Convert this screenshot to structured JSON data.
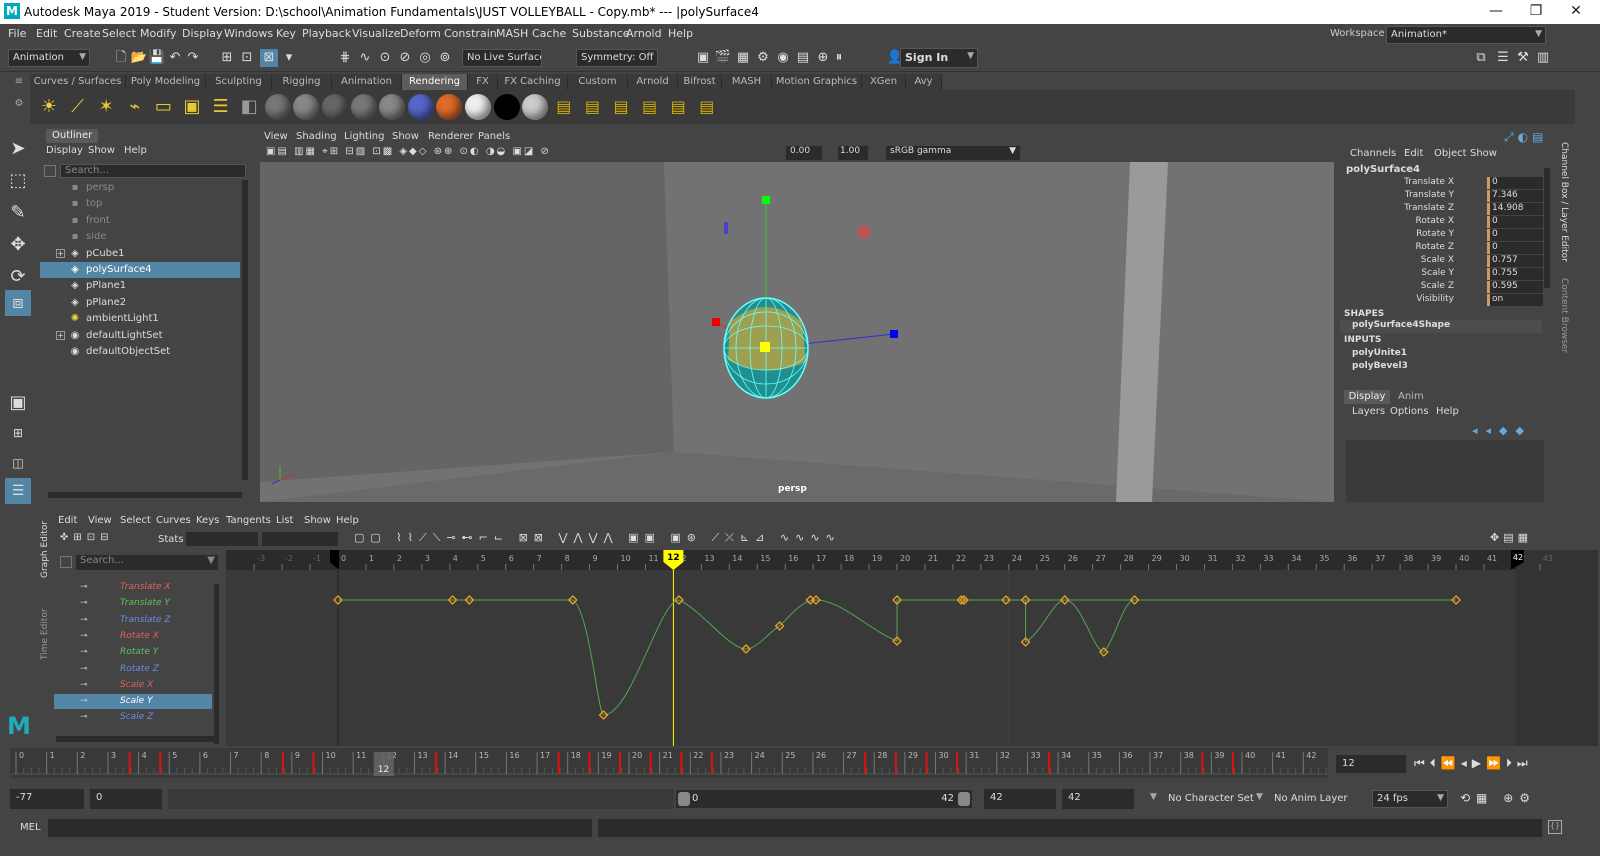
{
  "window": {
    "title": "Autodesk Maya 2019 - Student Version: D:\\school\\Animation Fundamentals\\JUST VOLLEYBALL - Copy.mb*  ---  |polySurface4",
    "controls": [
      "—",
      "❐",
      "✕"
    ]
  },
  "menubar": [
    "File",
    "Edit",
    "Create",
    "Select",
    "Modify",
    "Display",
    "Windows",
    "Key",
    "Playback",
    "Visualize",
    "Deform",
    "Constrain",
    "MASH",
    "Cache",
    "Substance",
    "Arnold",
    "Help"
  ],
  "workspace": {
    "label": "Workspace :",
    "value": "Animation*"
  },
  "toolbar": {
    "menuset": "Animation",
    "live_surface": "No Live Surface",
    "symmetry": "Symmetry: Off",
    "sign_in": "Sign In"
  },
  "shelf_tabs": [
    "Curves / Surfaces",
    "Poly Modeling",
    "Sculpting",
    "Rigging",
    "Animation",
    "Rendering",
    "FX",
    "FX Caching",
    "Custom",
    "Arnold",
    "Bifrost",
    "MASH",
    "Motion Graphics",
    "XGen",
    "Avy"
  ],
  "shelf_active": "Rendering",
  "outliner": {
    "tab": "Outliner",
    "menu": [
      "Display",
      "Show",
      "Help"
    ],
    "search_placeholder": "Search...",
    "items": [
      {
        "label": "persp",
        "icon": "camera-icon",
        "dim": true,
        "plus": false
      },
      {
        "label": "top",
        "icon": "camera-icon",
        "dim": true,
        "plus": false
      },
      {
        "label": "front",
        "icon": "camera-icon",
        "dim": true,
        "plus": false
      },
      {
        "label": "side",
        "icon": "camera-icon",
        "dim": true,
        "plus": false
      },
      {
        "label": "pCube1",
        "icon": "mesh-icon",
        "dim": false,
        "plus": true
      },
      {
        "label": "polySurface4",
        "icon": "mesh-icon",
        "dim": false,
        "plus": false,
        "selected": true
      },
      {
        "label": "pPlane1",
        "icon": "mesh-icon",
        "dim": false,
        "plus": false
      },
      {
        "label": "pPlane2",
        "icon": "mesh-icon",
        "dim": false,
        "plus": false
      },
      {
        "label": "ambientLight1",
        "icon": "light-icon",
        "dim": false,
        "plus": false
      },
      {
        "label": "defaultLightSet",
        "icon": "set-icon",
        "dim": false,
        "plus": true
      },
      {
        "label": "defaultObjectSet",
        "icon": "set-icon",
        "dim": false,
        "plus": false
      }
    ]
  },
  "viewport": {
    "menu": [
      "View",
      "Shading",
      "Lighting",
      "Show",
      "Renderer",
      "Panels"
    ],
    "exposure": "0.00",
    "gamma": "1.00",
    "colorspace": "sRGB gamma",
    "camera_label": "persp"
  },
  "channelbox": {
    "menu": [
      "Channels",
      "Edit",
      "Object",
      "Show"
    ],
    "object": "polySurface4",
    "channels": [
      {
        "name": "Translate X",
        "value": "0"
      },
      {
        "name": "Translate Y",
        "value": "7.346"
      },
      {
        "name": "Translate Z",
        "value": "14.908"
      },
      {
        "name": "Rotate X",
        "value": "0"
      },
      {
        "name": "Rotate Y",
        "value": "0"
      },
      {
        "name": "Rotate Z",
        "value": "0"
      },
      {
        "name": "Scale X",
        "value": "0.757"
      },
      {
        "name": "Scale Y",
        "value": "0.755"
      },
      {
        "name": "Scale Z",
        "value": "0.595"
      },
      {
        "name": "Visibility",
        "value": "on"
      }
    ],
    "shapes_header": "SHAPES",
    "shape": "polySurface4Shape",
    "inputs_header": "INPUTS",
    "inputs": [
      "polyUnite1",
      "polyBevel3"
    ],
    "layer_tabs": [
      "Display",
      "Anim"
    ],
    "layer_menu": [
      "Layers",
      "Options",
      "Help"
    ],
    "side_tabs": [
      "Channel Box / Layer Editor",
      "Content Browser"
    ]
  },
  "graph_editor": {
    "menu": [
      "Edit",
      "View",
      "Select",
      "Curves",
      "Keys",
      "Tangents",
      "List",
      "Show",
      "Help"
    ],
    "stats_label": "Stats",
    "search_placeholder": "Search...",
    "side_tabs": [
      "Graph Editor",
      "Time Editor"
    ],
    "curves": [
      {
        "label": "Translate X",
        "color": "#e06060"
      },
      {
        "label": "Translate Y",
        "color": "#60c060"
      },
      {
        "label": "Translate Z",
        "color": "#6a8ce0"
      },
      {
        "label": "Rotate X",
        "color": "#e06060"
      },
      {
        "label": "Rotate Y",
        "color": "#60c060"
      },
      {
        "label": "Rotate Z",
        "color": "#6a8ce0"
      },
      {
        "label": "Scale X",
        "color": "#e06060"
      },
      {
        "label": "Scale Y",
        "color": "#ffffff",
        "selected": true
      },
      {
        "label": "Scale Z",
        "color": "#6a8ce0"
      }
    ],
    "ruler": [
      "-3",
      "-2",
      "-1",
      "0",
      "1",
      "2",
      "3",
      "4",
      "5",
      "6",
      "7",
      "8",
      "9",
      "10",
      "11",
      "12",
      "13",
      "14",
      "15",
      "16",
      "17",
      "18",
      "19",
      "20",
      "21",
      "22",
      "23",
      "24",
      "25",
      "26",
      "27",
      "28",
      "29",
      "30",
      "31",
      "32",
      "33",
      "34",
      "35",
      "36",
      "37",
      "38",
      "39",
      "40",
      "41",
      "42",
      "43"
    ],
    "current_frame": "12",
    "end_frame": "42"
  },
  "timeslider": {
    "ticks": [
      "0",
      "1",
      "2",
      "3",
      "4",
      "5",
      "6",
      "7",
      "8",
      "9",
      "10",
      "11",
      "12",
      "13",
      "14",
      "15",
      "16",
      "17",
      "18",
      "19",
      "20",
      "21",
      "22",
      "23",
      "24",
      "25",
      "26",
      "27",
      "28",
      "29",
      "30",
      "31",
      "32",
      "33",
      "34",
      "35",
      "36",
      "37",
      "38",
      "39",
      "40",
      "41",
      "42"
    ],
    "keys": [
      4,
      5,
      9,
      10,
      14,
      18,
      19,
      20,
      21,
      22,
      23,
      28,
      29,
      30,
      31,
      34,
      39,
      40
    ],
    "current": "12",
    "current_field": "12"
  },
  "range": {
    "start_anim": "-77",
    "start": "0",
    "range_start": "0",
    "range_end": "42",
    "end": "42",
    "end_anim": "42",
    "character_set": "No Character Set",
    "anim_layer": "No Anim Layer",
    "fps": "24 fps"
  },
  "command": {
    "label": "MEL"
  }
}
